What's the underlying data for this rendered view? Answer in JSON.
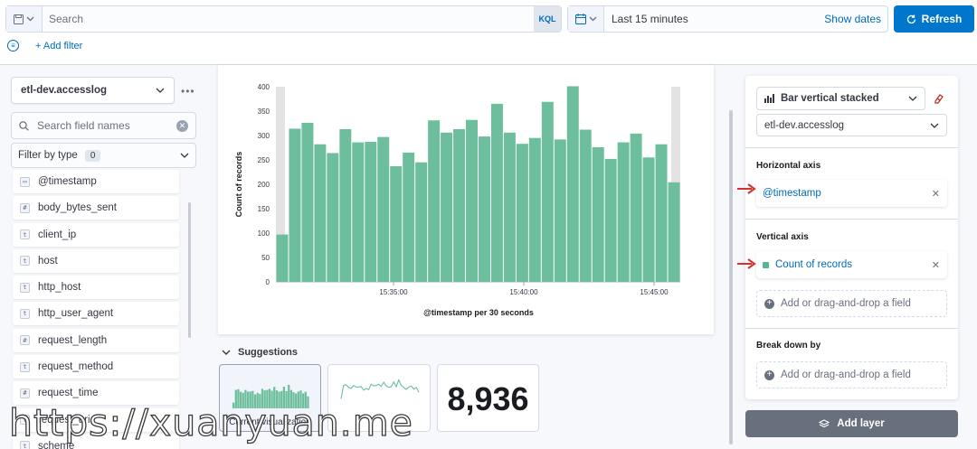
{
  "query": {
    "placeholder": "Search",
    "language_label": "KQL"
  },
  "time": {
    "range": "Last 15 minutes",
    "show_dates": "Show dates"
  },
  "refresh_label": "Refresh",
  "add_filter_label": "+ Add filter",
  "sidebar": {
    "index_pattern": "etl-dev.accesslog",
    "field_search_placeholder": "Search field names",
    "filter_by_type_label": "Filter by type",
    "filter_count": "0",
    "fields": [
      {
        "name": "@timestamp",
        "type": "date",
        "icon": "calendar-icon"
      },
      {
        "name": "body_bytes_sent",
        "type": "#",
        "icon": "number-icon"
      },
      {
        "name": "client_ip",
        "type": "t",
        "icon": "string-icon"
      },
      {
        "name": "host",
        "type": "t",
        "icon": "string-icon"
      },
      {
        "name": "http_host",
        "type": "t",
        "icon": "string-icon"
      },
      {
        "name": "http_user_agent",
        "type": "t",
        "icon": "string-icon"
      },
      {
        "name": "request_length",
        "type": "#",
        "icon": "number-icon"
      },
      {
        "name": "request_method",
        "type": "t",
        "icon": "string-icon"
      },
      {
        "name": "request_time",
        "type": "#",
        "icon": "number-icon"
      },
      {
        "name": "request_uri",
        "type": "t",
        "icon": "string-icon"
      },
      {
        "name": "scheme",
        "type": "t",
        "icon": "string-icon"
      }
    ]
  },
  "chart_data": {
    "type": "bar",
    "ylabel": "Count of records",
    "xlabel": "@timestamp per 30 seconds",
    "ylim": [
      0,
      400
    ],
    "yticks": [
      0,
      50,
      100,
      150,
      200,
      250,
      300,
      350,
      400
    ],
    "xticks": [
      "15:35:00",
      "15:40:00",
      "15:45:00"
    ],
    "values": [
      97,
      314,
      326,
      282,
      264,
      313,
      286,
      287,
      297,
      237,
      265,
      245,
      331,
      306,
      313,
      332,
      298,
      365,
      306,
      283,
      295,
      369,
      292,
      401,
      312,
      276,
      252,
      286,
      304,
      255,
      282,
      204
    ],
    "series_color": "#6dbe9c"
  },
  "suggestions": {
    "title": "Suggestions",
    "items": [
      {
        "label": "Current visualization"
      },
      {
        "label": ""
      },
      {
        "label": "",
        "metric": "8,936"
      }
    ]
  },
  "config": {
    "chart_type": "Bar vertical stacked",
    "layer_index": "etl-dev.accesslog",
    "horizontal_axis": {
      "title": "Horizontal axis",
      "field": "@timestamp"
    },
    "vertical_axis": {
      "title": "Vertical axis",
      "field": "Count of records",
      "add_label": "Add or drag-and-drop a field"
    },
    "break_down": {
      "title": "Break down by",
      "add_label": "Add or drag-and-drop a field"
    },
    "add_layer_label": "Add layer"
  },
  "watermark": "https://xuanyuan.me"
}
